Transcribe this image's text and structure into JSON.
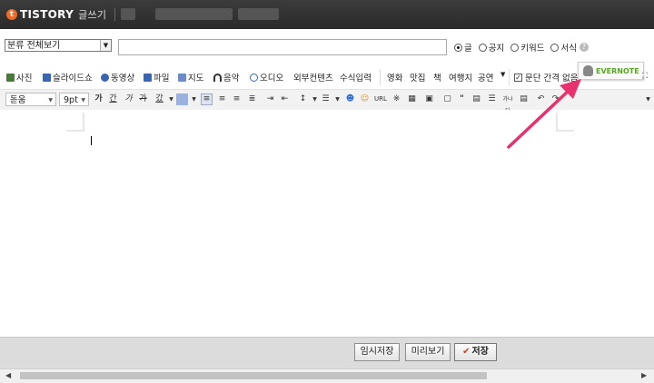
{
  "header": {
    "logo_text": "TISTORY",
    "page_label": "글쓰기"
  },
  "post": {
    "category_value": "분류 전체보기",
    "title_value": "",
    "post_types": [
      {
        "label": "글",
        "selected": true
      },
      {
        "label": "공지",
        "selected": false
      },
      {
        "label": "키워드",
        "selected": false
      },
      {
        "label": "서식",
        "selected": false
      }
    ]
  },
  "media_toolbar": {
    "items": [
      {
        "label": "사진",
        "icon": "photo-icon",
        "color": "#4a7a3a"
      },
      {
        "label": "슬라이드쇼",
        "icon": "slideshow-icon",
        "color": "#3a66b0"
      },
      {
        "label": "동영상",
        "icon": "video-icon",
        "color": "#3a66b0"
      },
      {
        "label": "파일",
        "icon": "file-icon",
        "color": "#3a66b0"
      },
      {
        "label": "지도",
        "icon": "map-icon",
        "color": "#3a66b0"
      },
      {
        "label": "음악",
        "icon": "music-icon",
        "color": "#333333"
      },
      {
        "label": "오디오",
        "icon": "audio-icon",
        "color": "#3a66b0"
      },
      {
        "label": "외부컨텐츠",
        "icon": "",
        "color": ""
      },
      {
        "label": "수식입력",
        "icon": "",
        "color": ""
      }
    ],
    "categories": [
      "영화",
      "맛집",
      "책",
      "여행지",
      "공연"
    ],
    "paragraph_option": "문단 간격 없음",
    "paragraph_option_checked": true,
    "evernote_label": "EVERNOTE"
  },
  "format_toolbar": {
    "font_family": "돋움",
    "font_size": "9pt",
    "style_buttons": [
      "가",
      "간",
      "가",
      "가",
      "갔"
    ],
    "link_text": "URL",
    "special_chars": "※",
    "quote_text": "\"",
    "small_text": "가나다"
  },
  "footer": {
    "temp_save_label": "임시저장",
    "preview_label": "미리보기",
    "save_label": "저장"
  },
  "colors": {
    "accent": "#f26a21",
    "annotation_arrow": "#e8326f",
    "evernote_green": "#5ba525"
  }
}
